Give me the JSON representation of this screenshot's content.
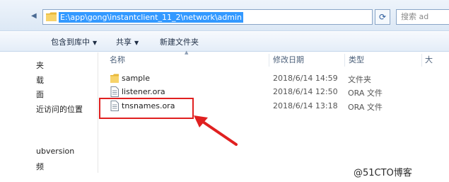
{
  "address_bar": {
    "path": "E:\\app\\gong\\instantclient_11_2\\network\\admin",
    "search_placeholder": "搜索 ad"
  },
  "toolbar": {
    "include_in_library": "包含到库中",
    "share": "共享",
    "new_folder": "新建文件夹"
  },
  "nav_pane": {
    "items": [
      "夹",
      "载",
      "面",
      "近访问的位置",
      "ubversion",
      "频"
    ]
  },
  "columns": {
    "name": "名称",
    "modified": "修改日期",
    "type": "类型",
    "size": "大"
  },
  "files": [
    {
      "name": "sample",
      "modified": "2018/6/14 14:59",
      "type": "文件夹",
      "icon": "folder-icon"
    },
    {
      "name": "listener.ora",
      "modified": "2018/6/14 12:50",
      "type": "ORA 文件",
      "icon": "file-icon"
    },
    {
      "name": "tnsnames.ora",
      "modified": "2018/6/14 13:18",
      "type": "ORA 文件",
      "icon": "file-icon"
    }
  ],
  "annotation": {
    "color": "#e02020"
  },
  "watermark": "@51CTO博客"
}
